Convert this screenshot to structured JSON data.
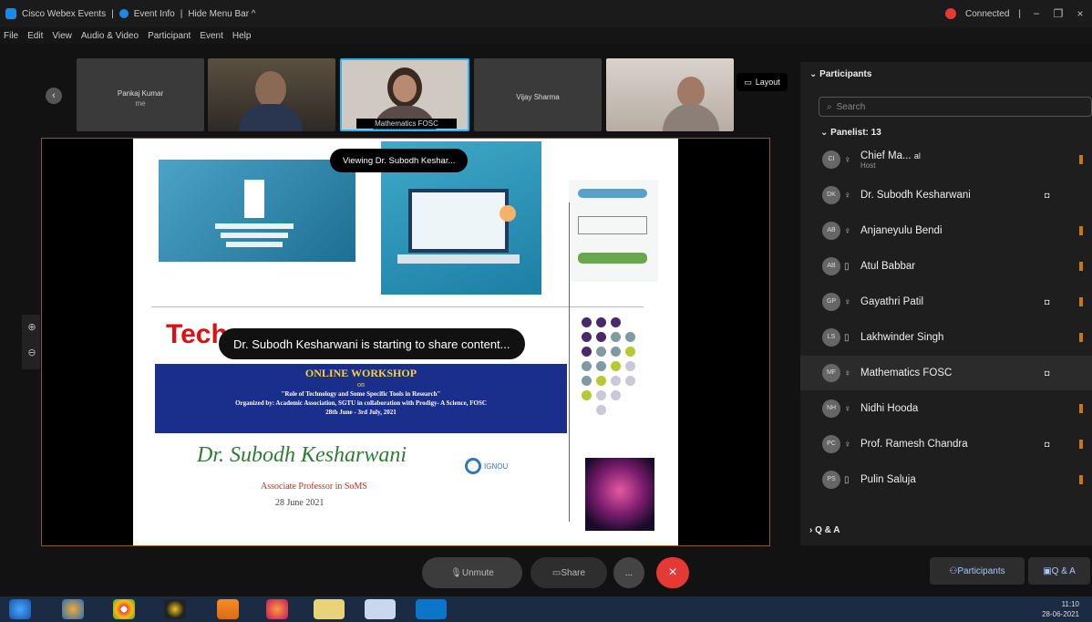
{
  "titlebar": {
    "app": "Cisco Webex Events",
    "event_info": "Event Info",
    "hide_menu": "Hide Menu Bar ^",
    "status": "Connected",
    "status_color": "#e53935"
  },
  "menu": [
    "File",
    "Edit",
    "View",
    "Audio & Video",
    "Participant",
    "Event",
    "Help"
  ],
  "video_tiles": [
    {
      "name": "Pankaj Kumar",
      "sub": "me"
    },
    {
      "name": ""
    },
    {
      "name": "Mathematics FOSC"
    },
    {
      "name": "Vijay Sharma"
    },
    {
      "name": ""
    }
  ],
  "layout_label": "Layout",
  "toasts": {
    "viewing": "Viewing Dr. Subodh Keshar...",
    "sharing": "Dr. Subodh Kesharwani is starting to share content..."
  },
  "slide": {
    "title_partial": "Tech",
    "workshop": "ONLINE WORKSHOP",
    "on": "on",
    "topic": "\"Role of Technology and Some Specific Tools in Research\"",
    "organized": "Organized by: Academic Association, SGTU in collaboration with Prodigy- A Science, FOSC",
    "dates": "28th June - 3rd July, 2021",
    "speaker": "Dr. Subodh Kesharwani",
    "designation": "Associate Professor in SoMS",
    "talk_date": "28 June 2021",
    "logo_text": "IGNOU"
  },
  "participants_panel": {
    "header": "Participants",
    "search_placeholder": "Search",
    "panelist_header": "Panelist: 13",
    "panelists": [
      {
        "initials": "CI",
        "name": "Chief Ma...",
        "extra": "al",
        "sub": "Host",
        "mic": "mic-icon",
        "cam": false
      },
      {
        "initials": "DK",
        "name": "Dr. Subodh Kesharwani",
        "mic": "mic-icon",
        "cam": true
      },
      {
        "initials": "AB",
        "name": "Anjaneyulu Bendi",
        "mic": "mic-icon",
        "cam": false
      },
      {
        "initials": "AB",
        "name": "Atul Babbar",
        "mic": "phone-icon",
        "cam": false
      },
      {
        "initials": "GP",
        "name": "Gayathri Patil",
        "mic": "mic-icon",
        "cam": true
      },
      {
        "initials": "LS",
        "name": "Lakhwinder Singh",
        "mic": "phone-icon",
        "cam": false
      },
      {
        "initials": "MF",
        "name": "Mathematics FOSC",
        "mic": "mic-icon",
        "cam": true,
        "selected": true
      },
      {
        "initials": "NH",
        "name": "Nidhi Hooda",
        "mic": "mic-icon",
        "cam": false
      },
      {
        "initials": "PC",
        "name": "Prof. Ramesh Chandra",
        "mic": "mic-icon",
        "cam": true
      },
      {
        "initials": "PS",
        "name": "Pulin Saluja",
        "mic": "phone-icon",
        "cam": false
      }
    ],
    "qa_header": "Q & A"
  },
  "controls": {
    "unmute": "Unmute",
    "share": "Share",
    "more": "...",
    "participants_btn": "Participants",
    "qa_btn": "Q & A"
  },
  "taskbar": {
    "time": "11:10",
    "date": "28-06-2021"
  }
}
